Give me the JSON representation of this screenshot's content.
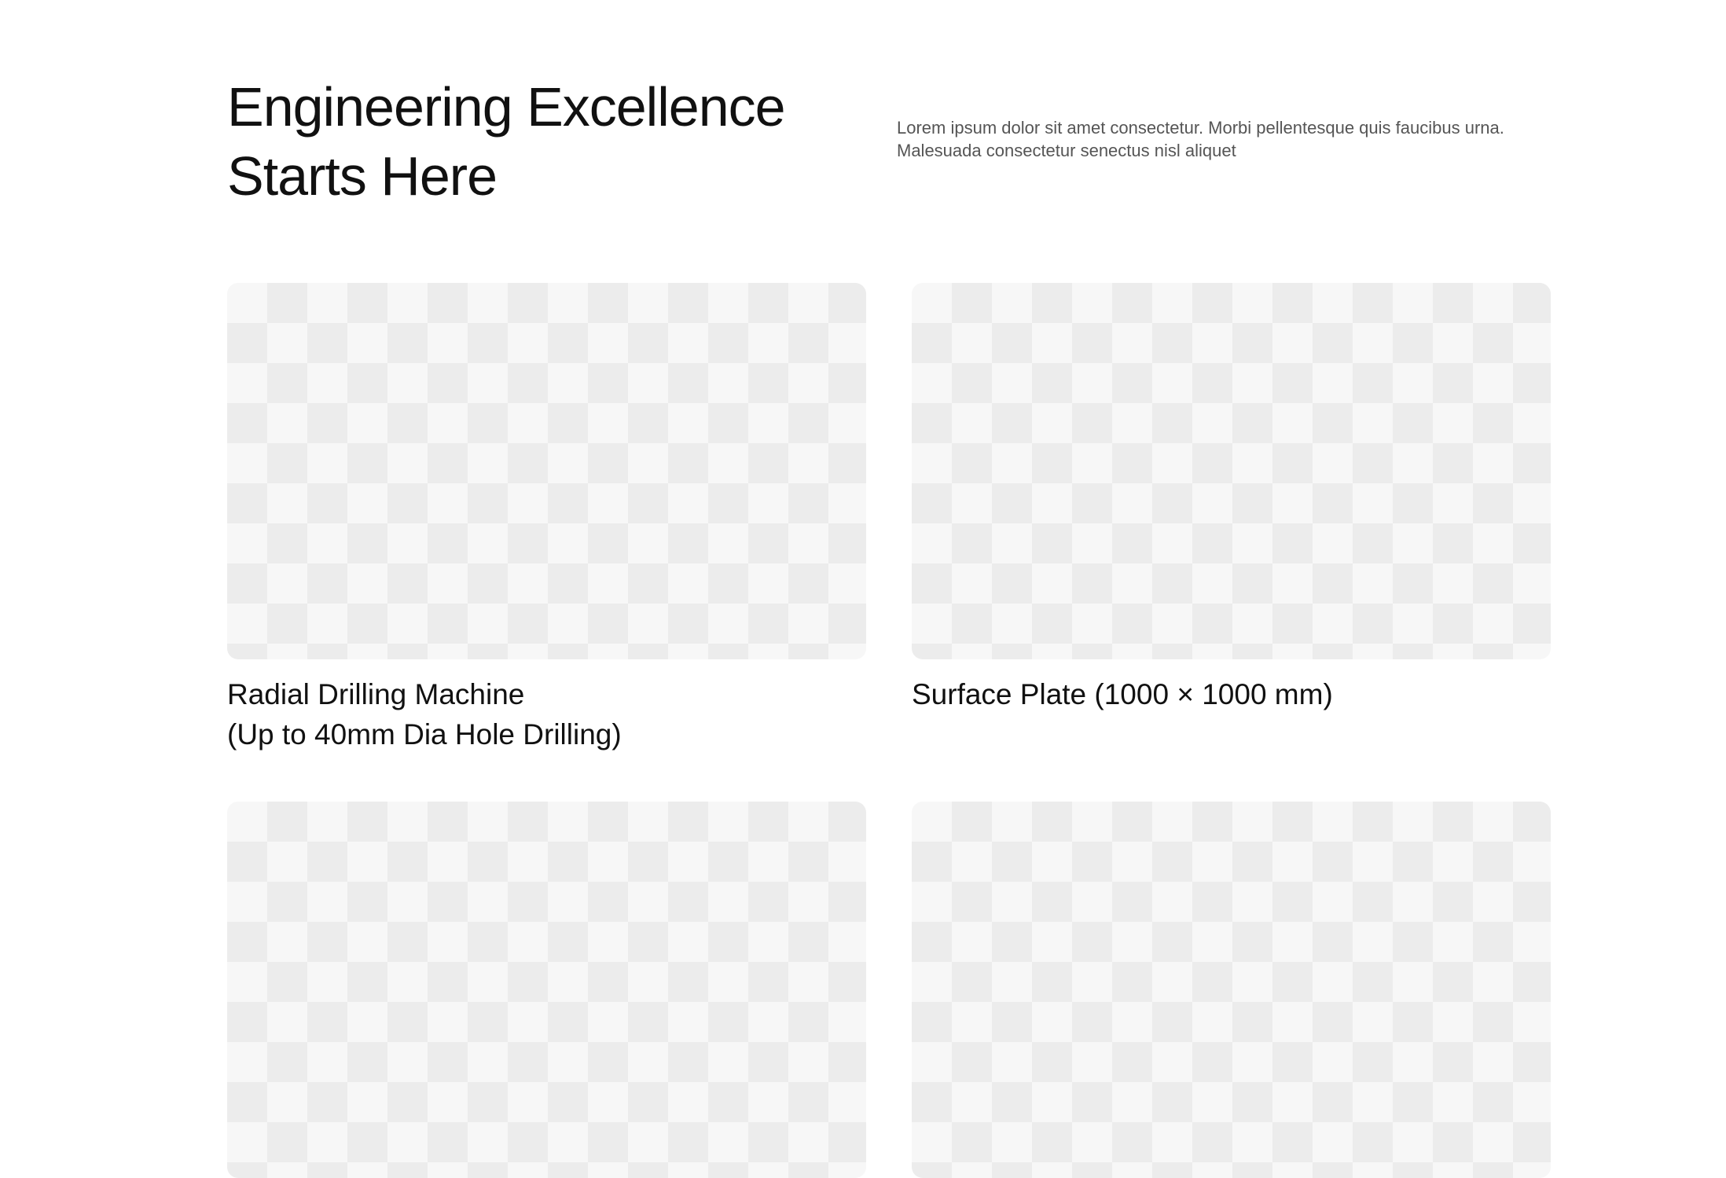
{
  "header": {
    "title_line1": "Engineering Excellence",
    "title_line2": "Starts Here",
    "description": "Lorem ipsum dolor sit amet consectetur. Morbi pellentesque quis faucibus urna. Malesuada consectetur senectus nisl aliquet"
  },
  "cards": [
    {
      "title_line1": "Radial Drilling Machine",
      "title_line2": "(Up to 40mm Dia Hole Drilling)"
    },
    {
      "title_line1": "Surface Plate  (1000 × 1000 mm)"
    },
    {},
    {}
  ],
  "colors": {
    "background": "#ffffff",
    "text": "#111111",
    "muted_text": "#555555",
    "placeholder_light": "#f7f7f7",
    "placeholder_dark": "#ececec"
  }
}
